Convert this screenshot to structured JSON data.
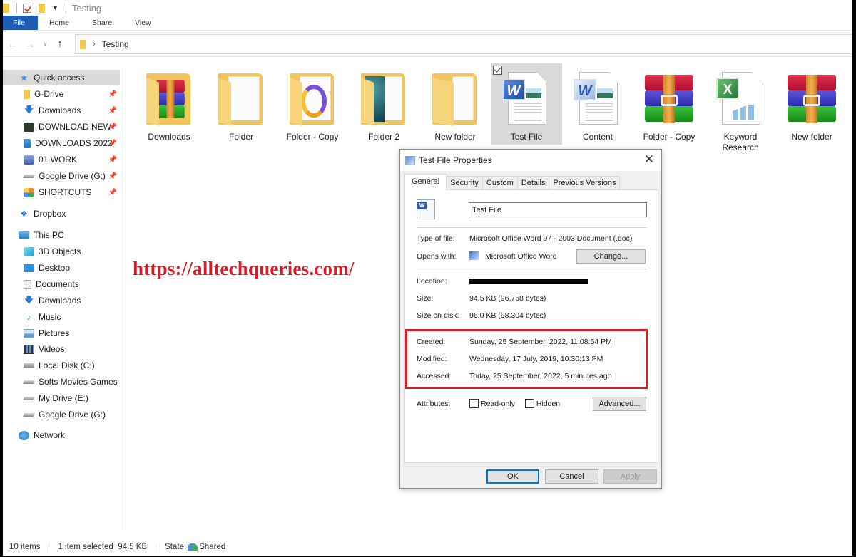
{
  "window": {
    "title": "Testing",
    "ribbon_tabs": [
      "File",
      "Home",
      "Share",
      "View"
    ],
    "address": {
      "path": [
        "Testing"
      ]
    }
  },
  "sidebar": {
    "quick_access": {
      "label": "Quick access",
      "icon": "star-icon"
    },
    "pinned": [
      {
        "label": "G-Drive",
        "icon": "folder-icon",
        "pinned": true
      },
      {
        "label": "Downloads",
        "icon": "download-arrow-icon",
        "pinned": true
      },
      {
        "label": "DOWNLOAD NEW",
        "icon": "dark-folder-icon",
        "pinned": true
      },
      {
        "label": "DOWNLOADS 2022",
        "icon": "blue-doc-icon",
        "pinned": true
      },
      {
        "label": "01 WORK",
        "icon": "work-icon",
        "pinned": true
      },
      {
        "label": "Google Drive (G:)",
        "icon": "drive-icon",
        "pinned": true
      },
      {
        "label": "SHORTCUTS",
        "icon": "shortcut-icon",
        "pinned": true
      }
    ],
    "dropbox": {
      "label": "Dropbox",
      "icon": "dropbox-icon"
    },
    "this_pc": {
      "label": "This PC",
      "icon": "pc-icon"
    },
    "pc_items": [
      {
        "label": "3D Objects",
        "icon": "3d-objects-icon"
      },
      {
        "label": "Desktop",
        "icon": "desktop-icon"
      },
      {
        "label": "Documents",
        "icon": "documents-icon"
      },
      {
        "label": "Downloads",
        "icon": "download-arrow-icon"
      },
      {
        "label": "Music",
        "icon": "music-icon"
      },
      {
        "label": "Pictures",
        "icon": "pictures-icon"
      },
      {
        "label": "Videos",
        "icon": "videos-icon"
      },
      {
        "label": "Local Disk (C:)",
        "icon": "local-disk-icon"
      },
      {
        "label": "Softs Movies Games (D:)",
        "icon": "drive-icon"
      },
      {
        "label": "My Drive (E:)",
        "icon": "drive-icon"
      },
      {
        "label": "Google Drive (G:)",
        "icon": "drive-icon"
      }
    ],
    "network": {
      "label": "Network",
      "icon": "network-icon"
    }
  },
  "files": [
    {
      "label": "Downloads",
      "type": "folder"
    },
    {
      "label": "Folder",
      "type": "folder"
    },
    {
      "label": "Folder - Copy",
      "type": "folder"
    },
    {
      "label": "Folder 2",
      "type": "folder"
    },
    {
      "label": "New folder",
      "type": "folder"
    },
    {
      "label": "Test File",
      "type": "word-doc",
      "selected": true
    },
    {
      "label": "Content",
      "type": "word-doc"
    },
    {
      "label": "Folder - Copy",
      "type": "archive"
    },
    {
      "label": "Keyword Research",
      "type": "excel"
    },
    {
      "label": "New folder",
      "type": "archive"
    }
  ],
  "watermark": "https://alltechqueries.com/",
  "statusbar": {
    "items_count": "10 items",
    "selection": "1 item selected  94.5 KB",
    "state_label": "State:",
    "state_value": "Shared"
  },
  "dialog": {
    "title": "Test File Properties",
    "tabs": [
      "General",
      "Security",
      "Custom",
      "Details",
      "Previous Versions"
    ],
    "active_tab": "General",
    "file_name": "Test File",
    "fields": {
      "type_label": "Type of file:",
      "type_value": "Microsoft Office Word 97 - 2003 Document (.doc)",
      "opens_label": "Opens with:",
      "opens_value": "Microsoft Office Word",
      "location_label": "Location:",
      "size_label": "Size:",
      "size_value": "94.5 KB (96,768 bytes)",
      "size_disk_label": "Size on disk:",
      "size_disk_value": "96.0 KB (98,304 bytes)",
      "created_label": "Created:",
      "created_value": "Sunday, 25 September, 2022, 11:08:54 PM",
      "modified_label": "Modified:",
      "modified_value": "Wednesday, 17 July, 2019, 10:30:13 PM",
      "accessed_label": "Accessed:",
      "accessed_value": "Today, 25 September, 2022, 5 minutes ago",
      "attributes_label": "Attributes:"
    },
    "attributes": [
      {
        "label": "Read-only",
        "checked": false
      },
      {
        "label": "Hidden",
        "checked": false
      }
    ],
    "buttons": {
      "change": "Change...",
      "advanced": "Advanced...",
      "ok": "OK",
      "cancel": "Cancel",
      "apply": "Apply"
    },
    "highlight_color": "#d71e2b"
  }
}
